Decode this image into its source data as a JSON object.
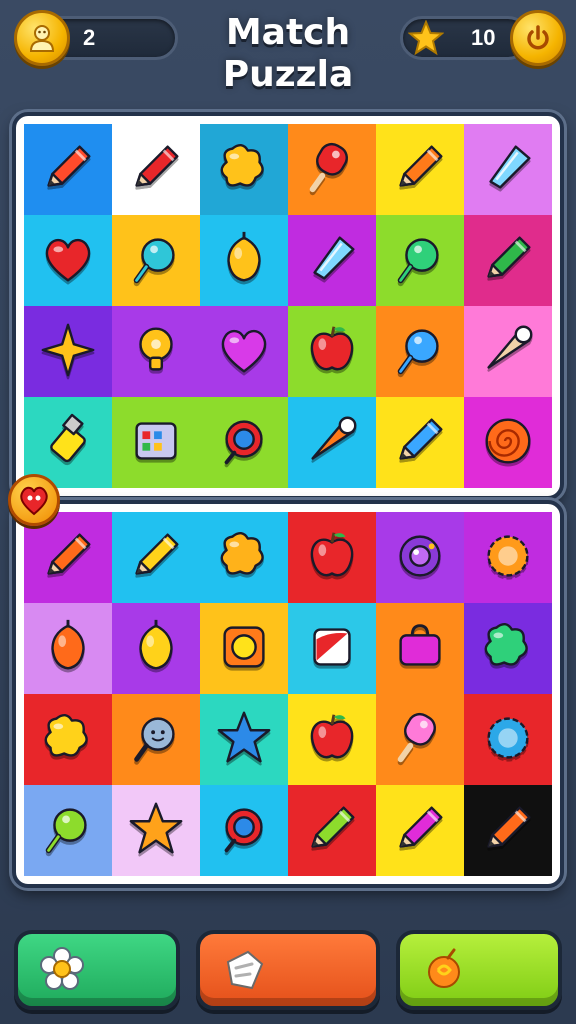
{
  "header": {
    "title_line1": "Match",
    "title_line2": "Puzzla",
    "moves_value": "2",
    "stars_value": "10",
    "left_icon": "smiley-coin-icon",
    "star_icon": "star-icon",
    "power_icon": "power-coin-icon"
  },
  "colors": {
    "background": "#34445c",
    "button_green": "#2cc06e",
    "button_orange": "#f2642a",
    "button_lime": "#9ad92a"
  },
  "board_top": [
    [
      {
        "bg": "#1f8ef0",
        "icon": "pencil",
        "c": "#ff4b2b"
      },
      {
        "bg": "#ffffff",
        "icon": "pencil",
        "c": "#e8262a"
      },
      {
        "bg": "#21a7d6",
        "icon": "blob",
        "c": "#ffc21a"
      },
      {
        "bg": "#ff8a1a",
        "icon": "pop",
        "c": "#e8262a"
      },
      {
        "bg": "#ffe21a",
        "icon": "pencil",
        "c": "#ff7a1a"
      },
      {
        "bg": "#e07cf2",
        "icon": "crystal",
        "c": "#7fd8ff"
      }
    ],
    [
      {
        "bg": "#21c1f0",
        "icon": "heart",
        "c": "#e8262a"
      },
      {
        "bg": "#ffc21a",
        "icon": "drop",
        "c": "#2fc6d8"
      },
      {
        "bg": "#21c1f0",
        "icon": "acorn",
        "c": "#ffc21a"
      },
      {
        "bg": "#c02ce0",
        "icon": "crystal",
        "c": "#7fd8ff"
      },
      {
        "bg": "#8ddc2c",
        "icon": "drop",
        "c": "#2fd07a"
      },
      {
        "bg": "#e02c8c",
        "icon": "pencil",
        "c": "#2fb84a"
      }
    ],
    [
      {
        "bg": "#7a2ce0",
        "icon": "star4",
        "c": "#ffc21a"
      },
      {
        "bg": "#a83ae8",
        "icon": "bulb",
        "c": "#ffc21a"
      },
      {
        "bg": "#a83ae8",
        "icon": "heart",
        "c": "#d83ae8"
      },
      {
        "bg": "#8ddc2c",
        "icon": "apple",
        "c": "#e8262a"
      },
      {
        "bg": "#ff8a1a",
        "icon": "drop",
        "c": "#3aa7ff"
      },
      {
        "bg": "#ff7ad8",
        "icon": "cone",
        "c": "#f2d2a8"
      }
    ],
    [
      {
        "bg": "#2cd8c0",
        "icon": "usb",
        "c": "#ffe21a"
      },
      {
        "bg": "#8ddc2c",
        "icon": "board",
        "c": "#c8c8f0"
      },
      {
        "bg": "#8ddc2c",
        "icon": "cookie",
        "c": "#e8262a"
      },
      {
        "bg": "#21c1f0",
        "icon": "cone",
        "c": "#ff7a1a"
      },
      {
        "bg": "#ffe21a",
        "icon": "pencil",
        "c": "#3aa7ff"
      },
      {
        "bg": "#e02cd8",
        "icon": "swirl",
        "c": "#ff6a1a"
      }
    ]
  ],
  "board_bottom": [
    [
      {
        "bg": "#c02ce0",
        "icon": "pencil",
        "c": "#ff6a1a"
      },
      {
        "bg": "#21c1f0",
        "icon": "pencil",
        "c": "#ffd21a"
      },
      {
        "bg": "#21c1f0",
        "icon": "blob",
        "c": "#ffb21a"
      },
      {
        "bg": "#e8262a",
        "icon": "apple",
        "c": "#e8262a"
      },
      {
        "bg": "#a83ae8",
        "icon": "orb",
        "c": "#8a3ad8"
      },
      {
        "bg": "#c02ce0",
        "icon": "gear",
        "c": "#ff9a1a"
      }
    ],
    [
      {
        "bg": "#d88af2",
        "icon": "acorn",
        "c": "#ff6a1a"
      },
      {
        "bg": "#a83ae8",
        "icon": "acorn",
        "c": "#ffd21a"
      },
      {
        "bg": "#ffc21a",
        "icon": "frame",
        "c": "#ff7a1a"
      },
      {
        "bg": "#2cc8e8",
        "icon": "box",
        "c": "#e8262a"
      },
      {
        "bg": "#ff8a1a",
        "icon": "bag",
        "c": "#e02cd8"
      },
      {
        "bg": "#7a2ce0",
        "icon": "blob",
        "c": "#2fd07a"
      }
    ],
    [
      {
        "bg": "#e8262a",
        "icon": "blob",
        "c": "#ffd21a"
      },
      {
        "bg": "#ff8a1a",
        "icon": "face",
        "c": "#9ab8d8"
      },
      {
        "bg": "#2cd8c0",
        "icon": "star",
        "c": "#2c8ae8"
      },
      {
        "bg": "#ffe21a",
        "icon": "apple",
        "c": "#e8262a"
      },
      {
        "bg": "#ff8a1a",
        "icon": "pop",
        "c": "#ff7ad8"
      },
      {
        "bg": "#e8262a",
        "icon": "gear",
        "c": "#2ca8e8"
      }
    ],
    [
      {
        "bg": "#7aa8f2",
        "icon": "drop",
        "c": "#8ddc2c"
      },
      {
        "bg": "#f2c8f8",
        "icon": "star",
        "c": "#ffa21a"
      },
      {
        "bg": "#21c1f0",
        "icon": "cookie",
        "c": "#e8262a"
      },
      {
        "bg": "#e8262a",
        "icon": "pencil",
        "c": "#8ddc2c"
      },
      {
        "bg": "#ffe21a",
        "icon": "pencil",
        "c": "#e02cd8"
      },
      {
        "bg": "#101010",
        "icon": "pencil",
        "c": "#ff6a1a"
      }
    ]
  ],
  "buttons": [
    {
      "name": "flower-button",
      "icon": "flower-icon"
    },
    {
      "name": "swap-button",
      "icon": "swap-icon"
    },
    {
      "name": "candy-button",
      "icon": "candy-icon"
    }
  ]
}
